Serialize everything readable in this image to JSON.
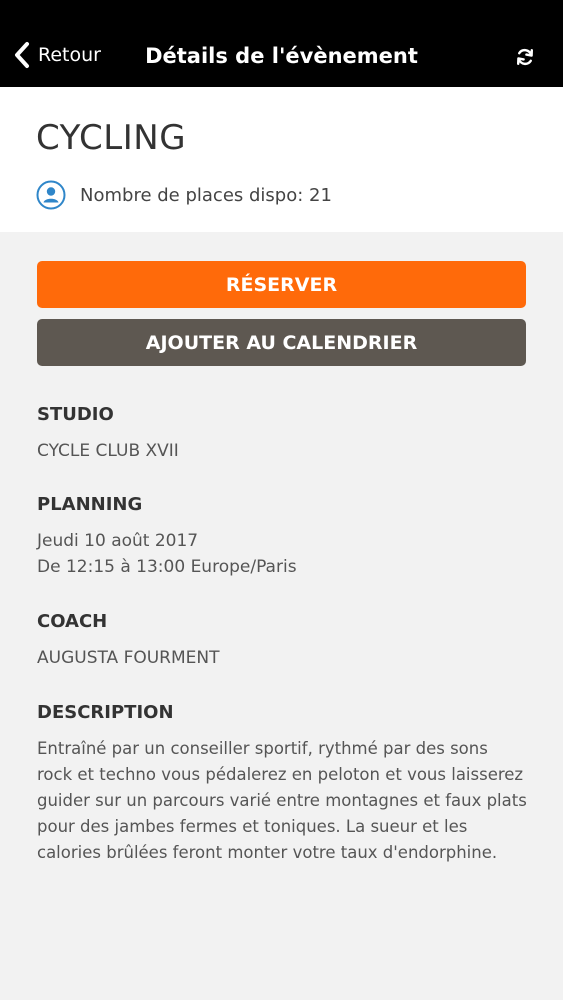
{
  "navbar": {
    "back_label": "Retour",
    "title": "Détails de l'évènement",
    "back_icon": "chevron-left-icon",
    "refresh_icon": "refresh-icon"
  },
  "event": {
    "title": "CYCLING",
    "places_icon": "user-circle-icon",
    "places_text": "Nombre de places dispo: 21"
  },
  "actions": {
    "reserve_label": "RÉSERVER",
    "calendar_label": "AJOUTER AU CALENDRIER"
  },
  "details": {
    "studio_label": "STUDIO",
    "studio_value": "CYCLE CLUB XVII",
    "planning_label": "PLANNING",
    "planning_date": "Jeudi 10 août 2017",
    "planning_time": "De 12:15 à 13:00 Europe/Paris",
    "coach_label": "COACH",
    "coach_value": "AUGUSTA FOURMENT",
    "description_label": "DESCRIPTION",
    "description_value": "Entraîné par un conseiller sportif, rythmé par des sons rock et techno vous pédalerez en peloton et vous laisserez guider sur un parcours varié entre montagnes et faux plats pour des jambes fermes et toniques. La sueur et les calories brûlées feront monter votre taux d'endorphine."
  },
  "colors": {
    "navbar": "#000000",
    "reserve": "#ff6a0a",
    "calendar": "#5e5851",
    "icon_accent": "#2f86c9"
  }
}
